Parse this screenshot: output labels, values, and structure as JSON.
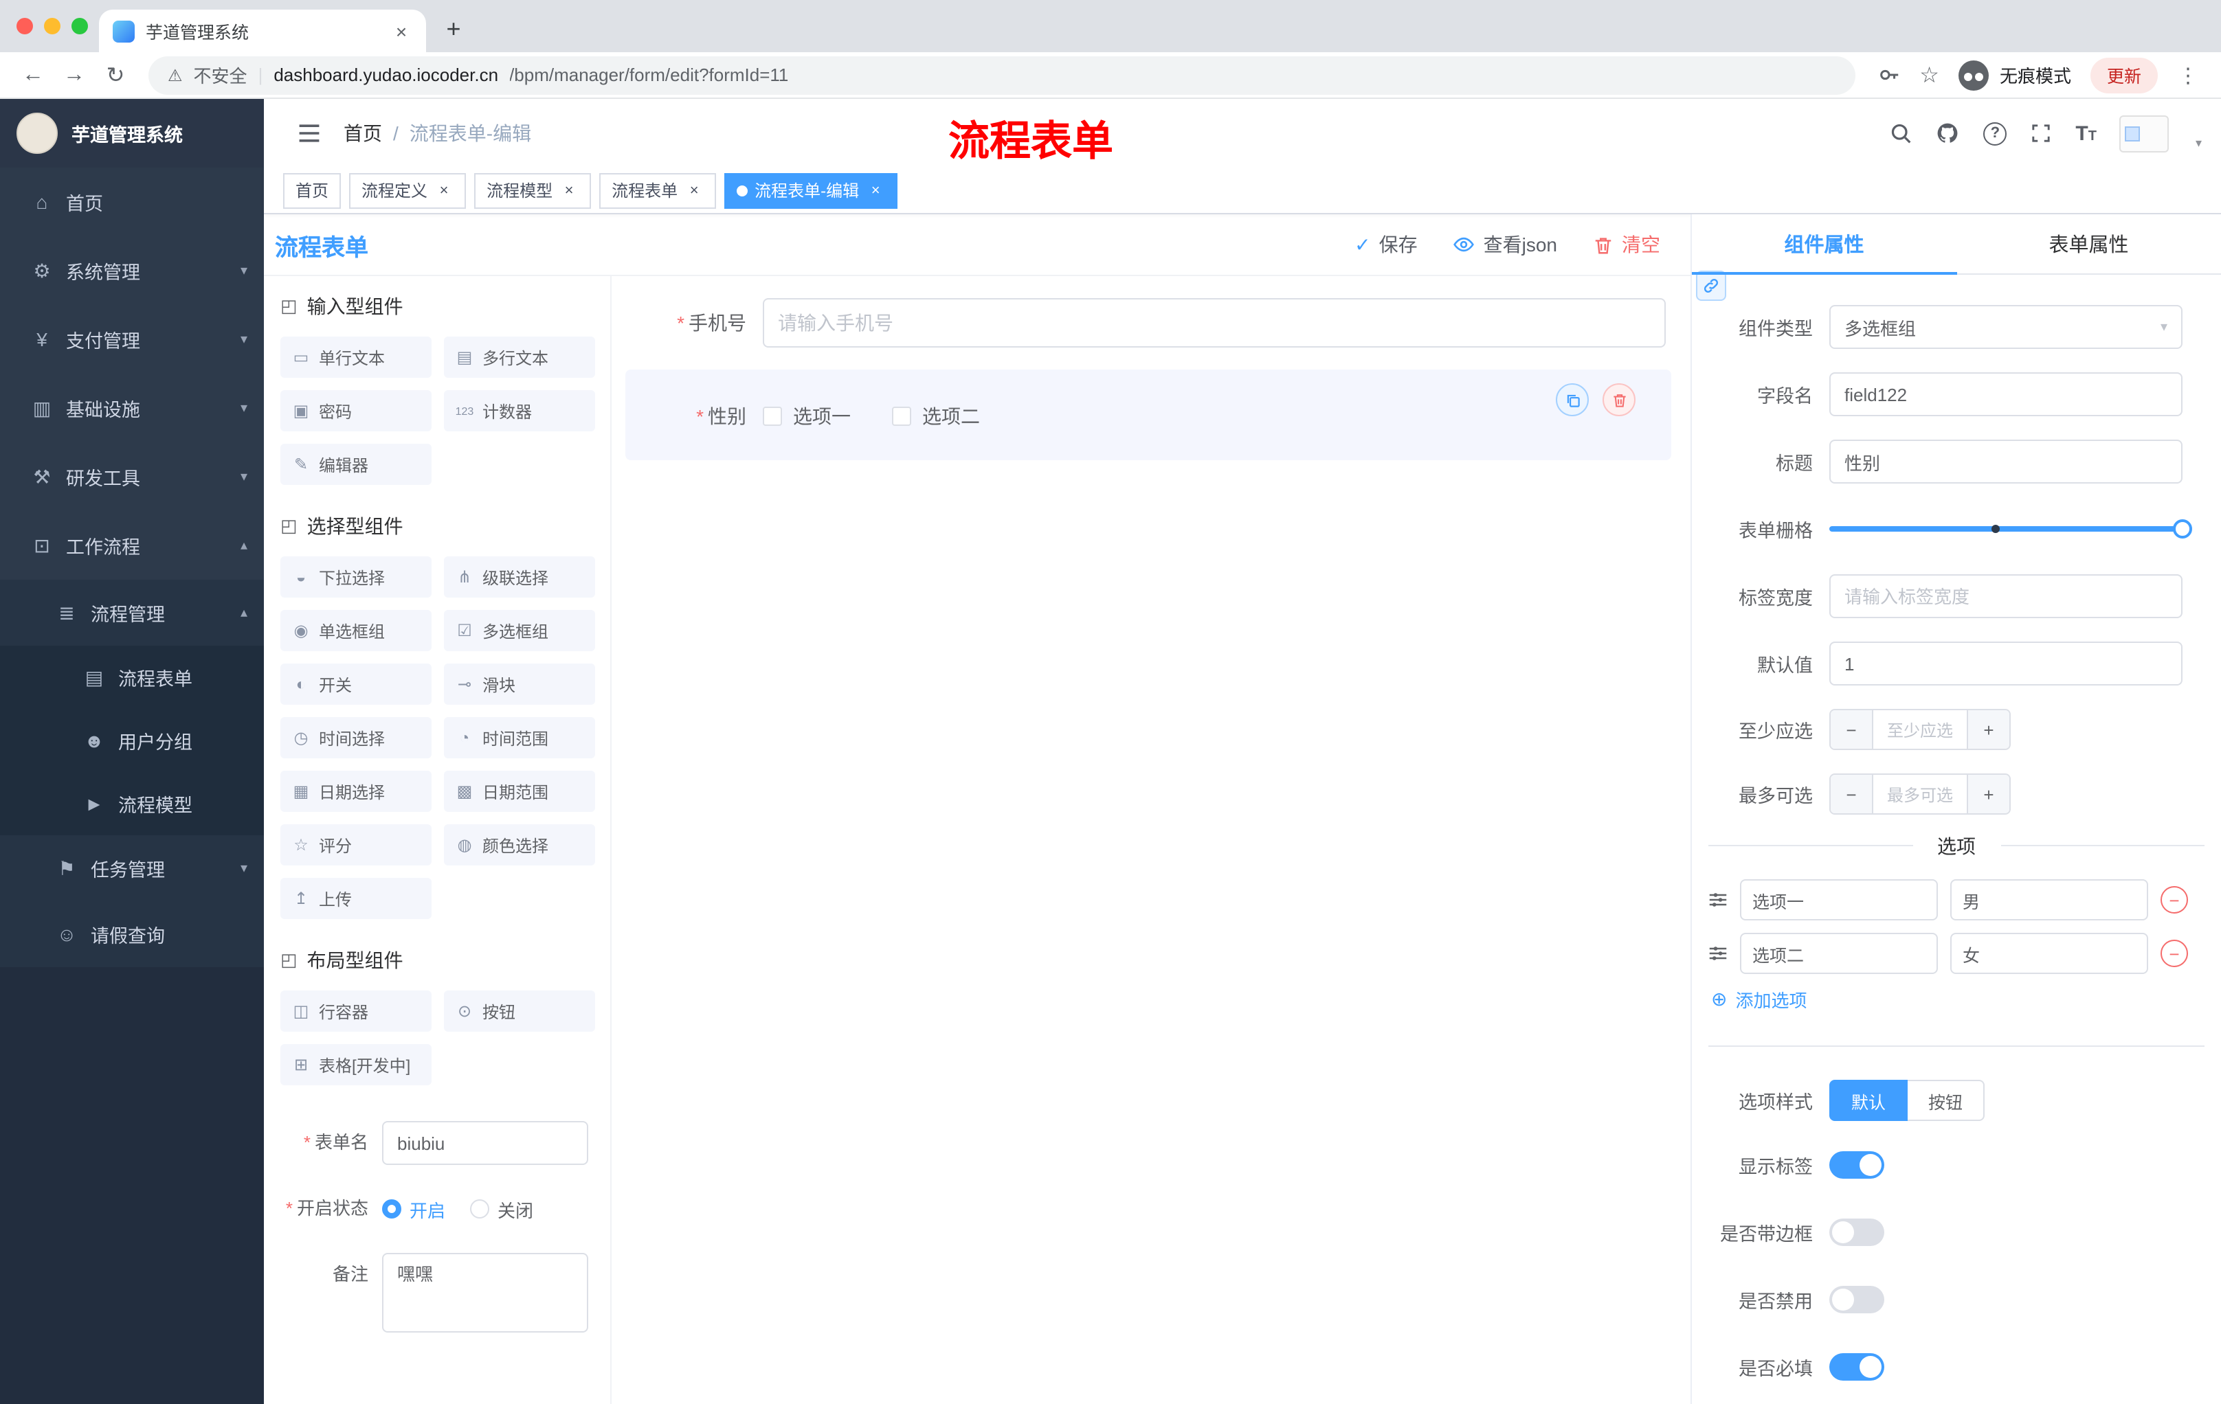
{
  "colors": {
    "accent": "#409eff",
    "danger": "#f56c6c",
    "overlay_title_red": "#ff0000",
    "sidebar_bg": "#2d3a4b",
    "tag_active_bg": "#409eff"
  },
  "browser": {
    "tab": {
      "title": "芋道管理系统"
    },
    "address": {
      "security": "不安全",
      "domain": "dashboard.yudao.iocoder.cn",
      "path": "/bpm/manager/form/edit?formId=11",
      "incognito": "无痕模式",
      "update": "更新"
    }
  },
  "sidebar": {
    "title": "芋道管理系统",
    "items": [
      {
        "label": "首页"
      },
      {
        "label": "系统管理"
      },
      {
        "label": "支付管理"
      },
      {
        "label": "基础设施"
      },
      {
        "label": "研发工具"
      },
      {
        "label": "工作流程"
      },
      {
        "label": "流程管理"
      },
      {
        "label": "流程表单"
      },
      {
        "label": "用户分组"
      },
      {
        "label": "流程模型"
      },
      {
        "label": "任务管理"
      },
      {
        "label": "请假查询"
      }
    ]
  },
  "header": {
    "breadcrumb_home": "首页",
    "breadcrumb_sep": "/",
    "breadcrumb_current": "流程表单-编辑",
    "overlay_title": "流程表单"
  },
  "tags": [
    {
      "label": "首页"
    },
    {
      "label": "流程定义"
    },
    {
      "label": "流程模型"
    },
    {
      "label": "流程表单"
    },
    {
      "label": "流程表单-编辑"
    }
  ],
  "designer": {
    "title": "流程表单",
    "save": "保存",
    "view_json": "查看json",
    "clear": "清空",
    "groups": [
      {
        "title": "输入型组件",
        "items": [
          "单行文本",
          "多行文本",
          "密码",
          "计数器",
          "编辑器"
        ]
      },
      {
        "title": "选择型组件",
        "items": [
          "下拉选择",
          "级联选择",
          "单选框组",
          "多选框组",
          "开关",
          "滑块",
          "时间选择",
          "时间范围",
          "日期选择",
          "日期范围",
          "评分",
          "颜色选择",
          "上传"
        ]
      },
      {
        "title": "布局型组件",
        "items": [
          "行容器",
          "按钮",
          "表格[开发中]"
        ]
      }
    ],
    "meta": {
      "form_name_label": "表单名",
      "form_name_value": "biubiu",
      "status_label": "开启状态",
      "status_on": "开启",
      "status_off": "关闭",
      "remark_label": "备注",
      "remark_value": "嘿嘿"
    },
    "canvas": {
      "phone_label": "手机号",
      "phone_placeholder": "请输入手机号",
      "gender_label": "性别",
      "gender_option1": "选项一",
      "gender_option2": "选项二"
    }
  },
  "props": {
    "tab_component": "组件属性",
    "tab_form": "表单属性",
    "component_type_label": "组件类型",
    "component_type_value": "多选框组",
    "field_name_label": "字段名",
    "field_name_value": "field122",
    "title_label": "标题",
    "title_value": "性别",
    "grid_label": "表单栅格",
    "label_width_label": "标签宽度",
    "label_width_placeholder": "请输入标签宽度",
    "default_label": "默认值",
    "default_value": "1",
    "min_label": "至少应选",
    "min_placeholder": "至少应选",
    "max_label": "最多可选",
    "max_placeholder": "最多可选",
    "options_title": "选项",
    "options": [
      {
        "label": "选项一",
        "value": "男"
      },
      {
        "label": "选项二",
        "value": "女"
      }
    ],
    "add_option": "添加选项",
    "style_label": "选项样式",
    "style_default": "默认",
    "style_button": "按钮",
    "toggle_show_label": "显示标签",
    "toggle_border": "是否带边框",
    "toggle_disabled": "是否禁用",
    "toggle_required": "是否必填"
  },
  "icons": {
    "close": "×",
    "plus": "+",
    "dots": "⋮",
    "warn": "⚠",
    "star": "☆",
    "pipe": "|",
    "back": "←",
    "forward": "→",
    "reload": "↻",
    "chev_down": "▾",
    "chev_up": "▴",
    "question": "?",
    "home": "⌂",
    "system": "⚙",
    "payment": "¥",
    "infra": "▥",
    "devtools": "⚒",
    "workflow": "⊡",
    "process_mgmt": "≣",
    "process_form": "▤",
    "user_group": "☻",
    "process_model": "►",
    "task_mgmt": "⚑",
    "leave": "☺",
    "section": "◰",
    "input": "▭",
    "textarea": "▤",
    "password": "▣",
    "counter": "123",
    "editor": "✎",
    "select": "◒",
    "cascader": "⋔",
    "radio_group": "◉",
    "checkbox_group": "☑",
    "switch": "◐",
    "slider": "⊸",
    "time": "◷",
    "time_range": "◔",
    "date": "▦",
    "date_range": "▩",
    "rate": "☆",
    "color": "◍",
    "upload": "↥",
    "row": "◫",
    "button": "⊙",
    "table": "⊞",
    "check": "✓",
    "minus": "−",
    "circle_plus": "⊕"
  }
}
